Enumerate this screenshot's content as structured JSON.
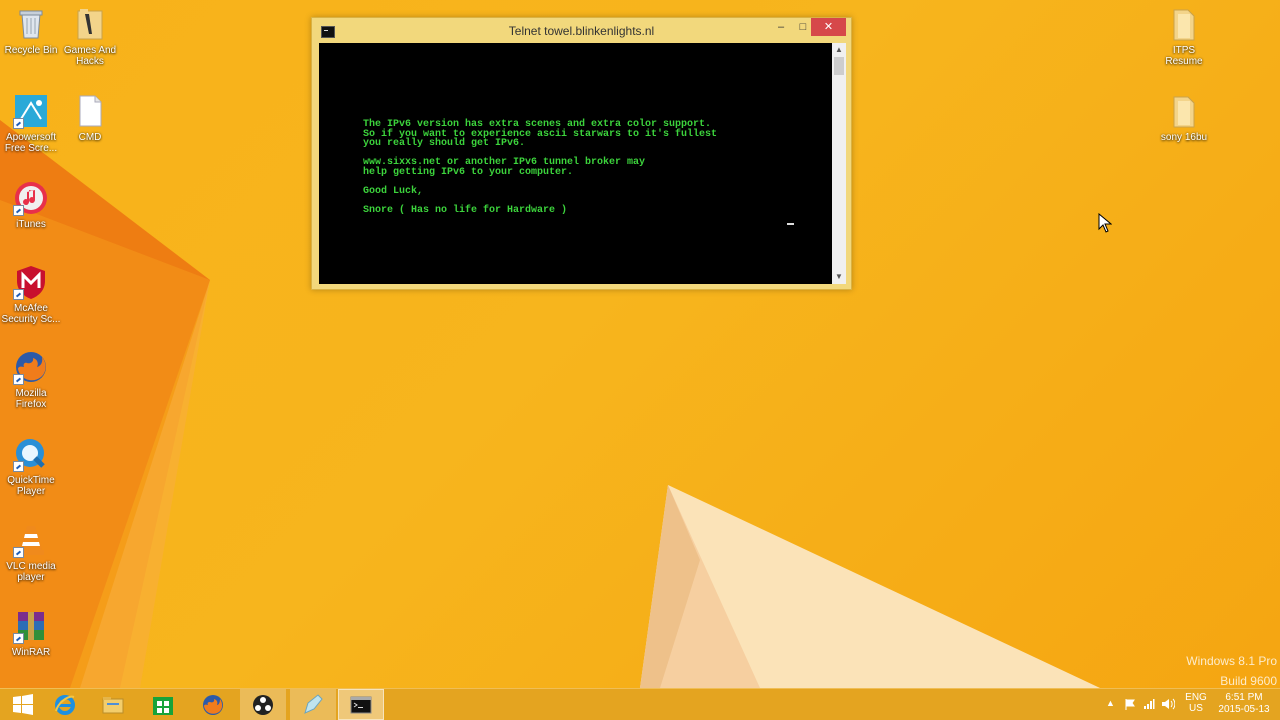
{
  "desktop": {
    "icons_left": [
      {
        "label": "Recycle Bin",
        "icon": "recycle-bin-icon"
      },
      {
        "label": "Games And Hacks",
        "icon": "folder-icon"
      },
      {
        "label": "Apowersoft Free Scre...",
        "icon": "apowersoft-icon"
      },
      {
        "label": "CMD",
        "icon": "file-icon"
      },
      {
        "label": "iTunes",
        "icon": "itunes-icon"
      },
      {
        "label": "McAfee Security Sc...",
        "icon": "mcafee-icon"
      },
      {
        "label": "Mozilla Firefox",
        "icon": "firefox-icon"
      },
      {
        "label": "QuickTime Player",
        "icon": "quicktime-icon"
      },
      {
        "label": "VLC media player",
        "icon": "vlc-icon"
      },
      {
        "label": "WinRAR",
        "icon": "winrar-icon"
      }
    ],
    "icons_right": [
      {
        "label": "ITPS Resume",
        "icon": "folder-icon"
      },
      {
        "label": "sony 16bu",
        "icon": "folder-icon"
      }
    ],
    "watermark_line1": "Windows 8.1 Pro",
    "watermark_line2": "Build 9600"
  },
  "window": {
    "title": "Telnet towel.blinkenlights.nl",
    "minimize": "–",
    "maximize": "□",
    "close": "✕",
    "console_text": "The IPv6 version has extra scenes and extra color support.\nSo if you want to experience ascii starwars to it's fullest\nyou really should get IPv6.\n\nwww.sixxs.net or another IPv6 tunnel broker may\nhelp getting IPv6 to your computer.\n\nGood Luck,\n\nSnore ( Has no life for Hardware )",
    "text_color": "#3cd33c"
  },
  "taskbar": {
    "items": [
      {
        "name": "start-button",
        "icon": "windows-logo-icon"
      },
      {
        "name": "internet-explorer",
        "icon": "ie-icon"
      },
      {
        "name": "file-explorer",
        "icon": "folder-icon"
      },
      {
        "name": "store",
        "icon": "store-icon"
      },
      {
        "name": "firefox",
        "icon": "firefox-icon"
      },
      {
        "name": "obs",
        "icon": "obs-icon"
      },
      {
        "name": "pencil-app",
        "icon": "pencil-icon"
      },
      {
        "name": "command-prompt",
        "icon": "cmd-icon"
      }
    ],
    "tray": {
      "lang_line1": "ENG",
      "lang_line2": "US",
      "time": "6:51 PM",
      "date": "2015-05-13"
    }
  },
  "colors": {
    "wallpaper": "#f7b21a",
    "taskbar": "#e4a420",
    "window_frame": "#f2d87c",
    "close_button": "#d6484a"
  }
}
